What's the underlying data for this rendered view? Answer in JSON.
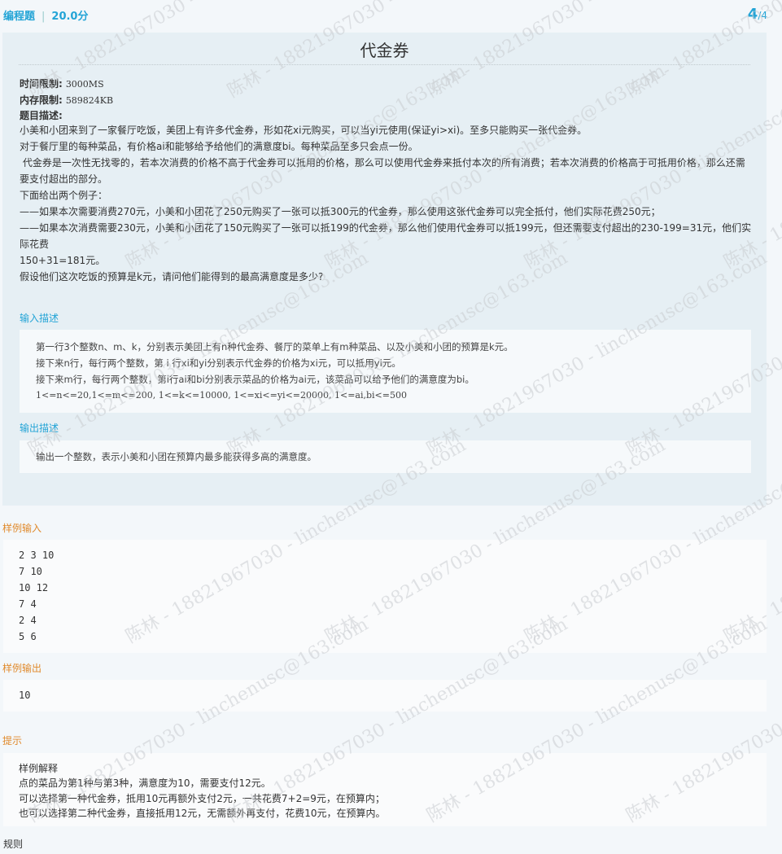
{
  "header": {
    "question_type": "编程题",
    "separator": "|",
    "score": "20.0分",
    "current_page": "4",
    "total_pages": "/4"
  },
  "problem": {
    "title": "代金券",
    "time_limit_label": "时间限制:",
    "time_limit_value": "3000MS",
    "memory_limit_label": "内存限制:",
    "memory_limit_value": "589824KB",
    "description_label": "题目描述:",
    "description_lines": [
      "小美和小团来到了一家餐厅吃饭，美团上有许多代金券，形如花xi元购买，可以当yi元使用(保证yi>xi)。至多只能购买一张代金券。",
      "对于餐厅里的每种菜品，有价格ai和能够给予给他们的满意度bi。每种菜品至多只会点一份。",
      " 代金券是一次性无找零的，若本次消费的价格不高于代金券可以抵用的价格，那么可以使用代金券来抵付本次的所有消费；若本次消费的价格高于可抵用价格，那么还需",
      "要支付超出的部分。",
      "下面给出两个例子：",
      "——如果本次需要消费270元，小美和小团花了250元购买了一张可以抵300元的代金券，那么使用这张代金券可以完全抵付，他们实际花费250元；",
      "——如果本次消费需要230元，小美和小团花了150元购买了一张可以抵199的代金券，那么他们使用代金券可以抵199元，但还需要支付超出的230-199=31元，他们实际花费",
      "150+31=181元。",
      "假设他们这次吃饭的预算是k元，请问他们能得到的最高满意度是多少?"
    ],
    "input_label": "输入描述",
    "input_lines": [
      "第一行3个整数n、m、k，分别表示美团上有n种代金券、餐厅的菜单上有m种菜品、以及小美和小团的预算是k元。",
      "接下来n行，每行两个整数，第 i 行xi和yi分别表示代金券的价格为xi元，可以抵用yi元。",
      "接下来m行，每行两个整数，第i行ai和bi分别表示菜品的价格为ai元，该菜品可以给予他们的满意度为bi。",
      "1<=n<=20,1<=m<=200, 1<=k<=10000, 1<=xi<=yi<=20000, 1<=ai,bi<=500"
    ],
    "output_label": "输出描述",
    "output_lines": [
      "输出一个整数，表示小美和小团在预算内最多能获得多高的满意度。"
    ]
  },
  "sample_input": {
    "label": "样例输入",
    "lines": [
      "2 3 10",
      "7 10",
      "10 12",
      "7 4",
      "2 4",
      "5 6"
    ]
  },
  "sample_output": {
    "label": "样例输出",
    "lines": [
      "10"
    ]
  },
  "hint": {
    "label": "提示",
    "lines": [
      "样例解释",
      "点的菜品为第1种与第3种，满意度为10，需要支付12元。",
      "可以选择第一种代金券，抵用10元再额外支付2元，一共花费7+2=9元，在预算内；",
      "也可以选择第二种代金券，直接抵用12元，无需额外再支付，花费10元，在预算内。"
    ]
  },
  "rules_label": "规则",
  "watermark": {
    "name_text": "陈林 - 18821967030 - linchenusc@163.com",
    "color": "#c8ccd0"
  },
  "colors": {
    "accent": "#23a4d6",
    "orange": "#e08a2c",
    "panel": "#e6eff4",
    "background": "#f3f7fa"
  }
}
